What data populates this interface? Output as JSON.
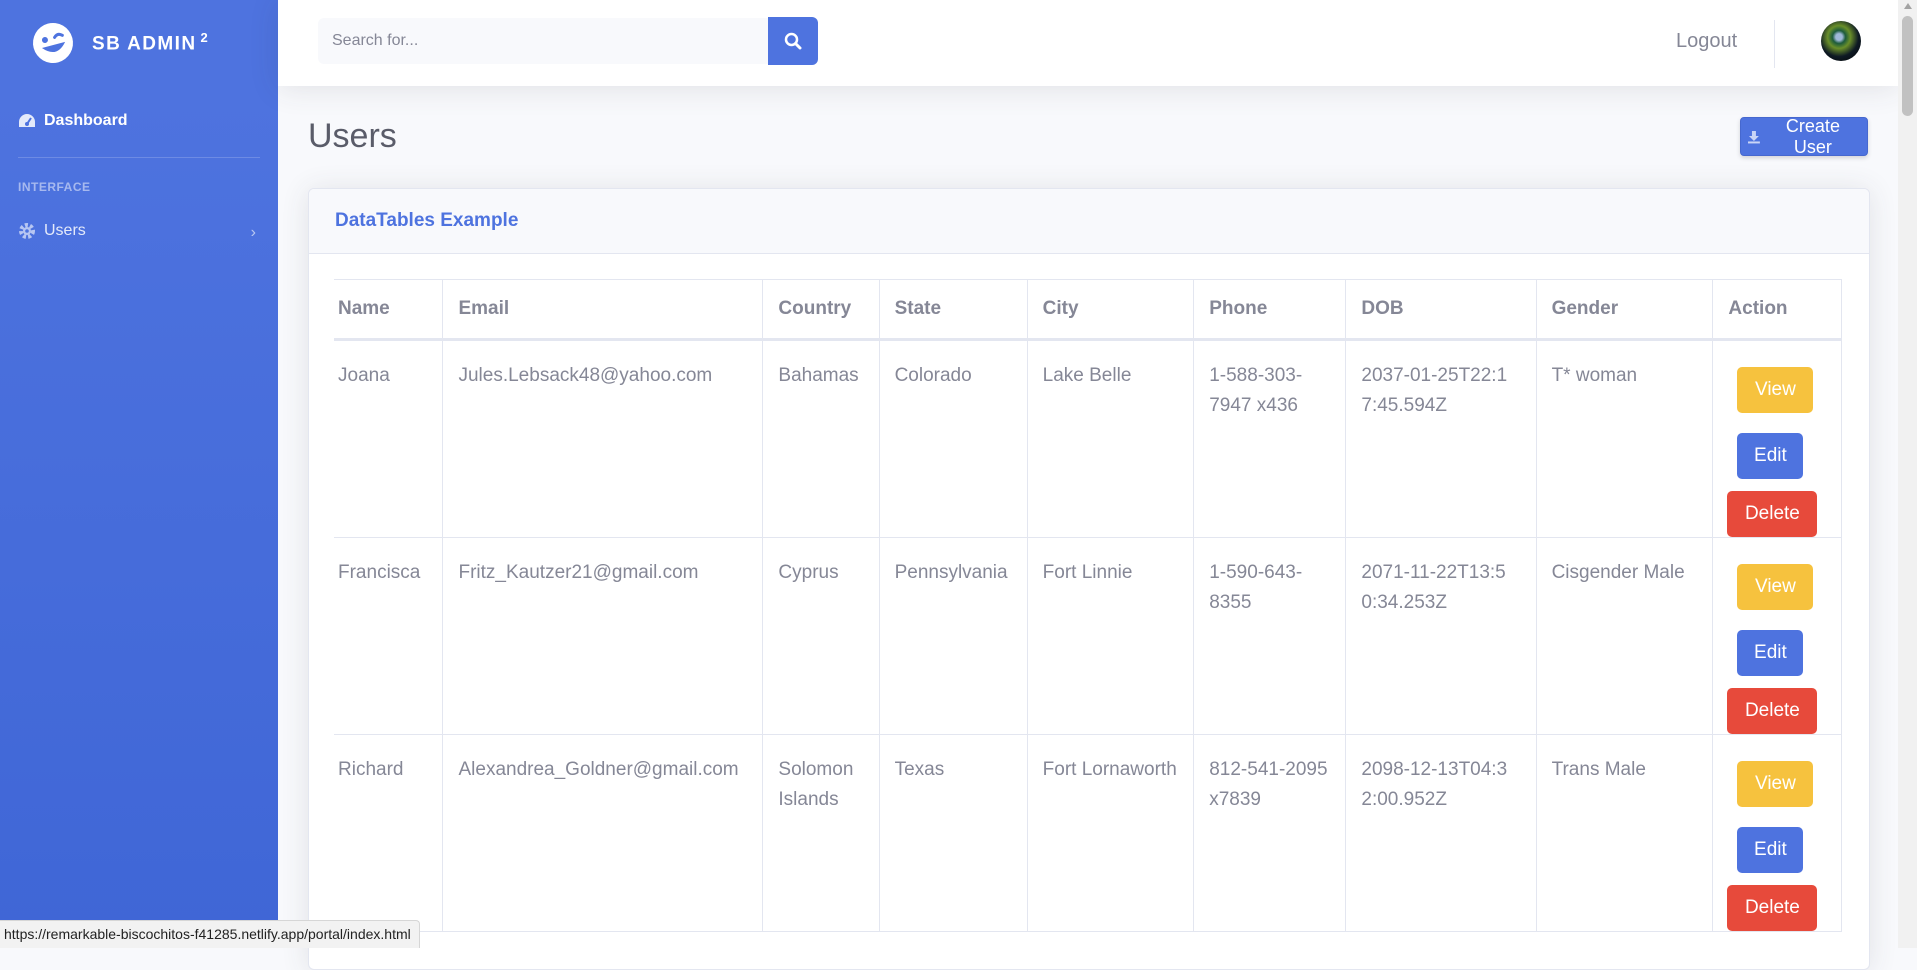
{
  "sidebar": {
    "brand": "SB ADMIN",
    "brand_sup": "2",
    "dashboard_label": "Dashboard",
    "section_heading": "INTERFACE",
    "users_label": "Users"
  },
  "topbar": {
    "search_placeholder": "Search for...",
    "logout_label": "Logout"
  },
  "main": {
    "page_title": "Users",
    "create_button_label": "Create User",
    "card_title": "DataTables Example",
    "columns": [
      "Name",
      "Email",
      "Country",
      "State",
      "City",
      "Phone",
      "DOB",
      "Gender",
      "Action"
    ],
    "rows": [
      {
        "name": "Joana",
        "email": "Jules.Lebsack48@yahoo.com",
        "country": "Bahamas",
        "state": "Colorado",
        "city": "Lake Belle",
        "phone": "1-588-303-7947 x436",
        "dob": "2037-01-25T22:17:45.594Z",
        "gender": "T* woman"
      },
      {
        "name": "Francisca",
        "email": "Fritz_Kautzer21@gmail.com",
        "country": "Cyprus",
        "state": "Pennsylvania",
        "city": "Fort Linnie",
        "phone": "1-590-643-8355",
        "dob": "2071-11-22T13:50:34.253Z",
        "gender": "Cisgender Male"
      },
      {
        "name": "Richard",
        "email": "Alexandrea_Goldner@gmail.com",
        "country": "Solomon Islands",
        "state": "Texas",
        "city": "Fort Lornaworth",
        "phone": "812-541-2095 x7839",
        "dob": "2098-12-13T04:32:00.952Z",
        "gender": "Trans Male"
      }
    ],
    "action_labels": {
      "view": "View",
      "edit": "Edit",
      "delete": "Delete"
    }
  },
  "statusbar": {
    "url": "https://remarkable-biscochitos-f41285.netlify.app/portal/index.html"
  },
  "colors": {
    "primary": "#4e73df",
    "warning": "#f6c23e",
    "danger": "#e74a3b",
    "text_muted": "#858796"
  }
}
